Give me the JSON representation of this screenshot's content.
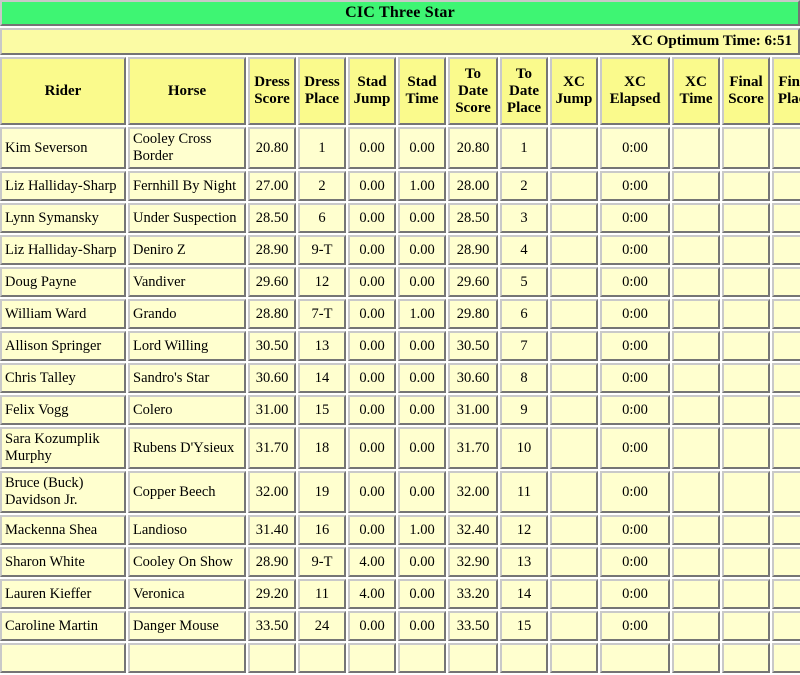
{
  "banner": {
    "title": "CIC Three Star"
  },
  "optimum_time": {
    "label": "XC Optimum Time: 6:51"
  },
  "table": {
    "columns": [
      "Rider",
      "Horse",
      "Dress Score",
      "Dress Place",
      "Stad Jump",
      "Stad Time",
      "To Date Score",
      "To Date Place",
      "XC Jump",
      "XC Elapsed",
      "XC Time",
      "Final Score",
      "Final Place"
    ],
    "column_lines": [
      [
        "Rider"
      ],
      [
        "Horse"
      ],
      [
        "Dress",
        "Score"
      ],
      [
        "Dress",
        "Place"
      ],
      [
        "Stad",
        "Jump"
      ],
      [
        "Stad",
        "Time"
      ],
      [
        "To",
        "Date",
        "Score"
      ],
      [
        "To",
        "Date",
        "Place"
      ],
      [
        "XC",
        "Jump"
      ],
      [
        "XC",
        "Elapsed"
      ],
      [
        "XC",
        "Time"
      ],
      [
        "Final",
        "Score"
      ],
      [
        "Final",
        "Place"
      ]
    ],
    "rows": [
      {
        "rider": "Kim Severson",
        "horse": "Cooley Cross Border",
        "dress_score": "20.80",
        "dress_place": "1",
        "stad_jump": "0.00",
        "stad_time": "0.00",
        "to_date_score": "20.80",
        "to_date_place": "1",
        "xc_jump": "",
        "xc_elapsed": "0:00",
        "xc_time": "",
        "final_score": "",
        "final_place": ""
      },
      {
        "rider": "Liz Halliday-Sharp",
        "horse": "Fernhill By Night",
        "dress_score": "27.00",
        "dress_place": "2",
        "stad_jump": "0.00",
        "stad_time": "1.00",
        "to_date_score": "28.00",
        "to_date_place": "2",
        "xc_jump": "",
        "xc_elapsed": "0:00",
        "xc_time": "",
        "final_score": "",
        "final_place": ""
      },
      {
        "rider": "Lynn Symansky",
        "horse": "Under Suspection",
        "dress_score": "28.50",
        "dress_place": "6",
        "stad_jump": "0.00",
        "stad_time": "0.00",
        "to_date_score": "28.50",
        "to_date_place": "3",
        "xc_jump": "",
        "xc_elapsed": "0:00",
        "xc_time": "",
        "final_score": "",
        "final_place": ""
      },
      {
        "rider": "Liz Halliday-Sharp",
        "horse": "Deniro Z",
        "dress_score": "28.90",
        "dress_place": "9-T",
        "stad_jump": "0.00",
        "stad_time": "0.00",
        "to_date_score": "28.90",
        "to_date_place": "4",
        "xc_jump": "",
        "xc_elapsed": "0:00",
        "xc_time": "",
        "final_score": "",
        "final_place": ""
      },
      {
        "rider": "Doug Payne",
        "horse": "Vandiver",
        "dress_score": "29.60",
        "dress_place": "12",
        "stad_jump": "0.00",
        "stad_time": "0.00",
        "to_date_score": "29.60",
        "to_date_place": "5",
        "xc_jump": "",
        "xc_elapsed": "0:00",
        "xc_time": "",
        "final_score": "",
        "final_place": ""
      },
      {
        "rider": "William Ward",
        "horse": "Grando",
        "dress_score": "28.80",
        "dress_place": "7-T",
        "stad_jump": "0.00",
        "stad_time": "1.00",
        "to_date_score": "29.80",
        "to_date_place": "6",
        "xc_jump": "",
        "xc_elapsed": "0:00",
        "xc_time": "",
        "final_score": "",
        "final_place": ""
      },
      {
        "rider": "Allison Springer",
        "horse": "Lord Willing",
        "dress_score": "30.50",
        "dress_place": "13",
        "stad_jump": "0.00",
        "stad_time": "0.00",
        "to_date_score": "30.50",
        "to_date_place": "7",
        "xc_jump": "",
        "xc_elapsed": "0:00",
        "xc_time": "",
        "final_score": "",
        "final_place": ""
      },
      {
        "rider": "Chris Talley",
        "horse": "Sandro's Star",
        "dress_score": "30.60",
        "dress_place": "14",
        "stad_jump": "0.00",
        "stad_time": "0.00",
        "to_date_score": "30.60",
        "to_date_place": "8",
        "xc_jump": "",
        "xc_elapsed": "0:00",
        "xc_time": "",
        "final_score": "",
        "final_place": ""
      },
      {
        "rider": "Felix Vogg",
        "horse": "Colero",
        "dress_score": "31.00",
        "dress_place": "15",
        "stad_jump": "0.00",
        "stad_time": "0.00",
        "to_date_score": "31.00",
        "to_date_place": "9",
        "xc_jump": "",
        "xc_elapsed": "0:00",
        "xc_time": "",
        "final_score": "",
        "final_place": ""
      },
      {
        "rider": "Sara Kozumplik Murphy",
        "horse": "Rubens D'Ysieux",
        "dress_score": "31.70",
        "dress_place": "18",
        "stad_jump": "0.00",
        "stad_time": "0.00",
        "to_date_score": "31.70",
        "to_date_place": "10",
        "xc_jump": "",
        "xc_elapsed": "0:00",
        "xc_time": "",
        "final_score": "",
        "final_place": ""
      },
      {
        "rider": "Bruce (Buck) Davidson Jr.",
        "horse": "Copper Beech",
        "dress_score": "32.00",
        "dress_place": "19",
        "stad_jump": "0.00",
        "stad_time": "0.00",
        "to_date_score": "32.00",
        "to_date_place": "11",
        "xc_jump": "",
        "xc_elapsed": "0:00",
        "xc_time": "",
        "final_score": "",
        "final_place": ""
      },
      {
        "rider": "Mackenna Shea",
        "horse": "Landioso",
        "dress_score": "31.40",
        "dress_place": "16",
        "stad_jump": "0.00",
        "stad_time": "1.00",
        "to_date_score": "32.40",
        "to_date_place": "12",
        "xc_jump": "",
        "xc_elapsed": "0:00",
        "xc_time": "",
        "final_score": "",
        "final_place": ""
      },
      {
        "rider": "Sharon White",
        "horse": "Cooley On Show",
        "dress_score": "28.90",
        "dress_place": "9-T",
        "stad_jump": "4.00",
        "stad_time": "0.00",
        "to_date_score": "32.90",
        "to_date_place": "13",
        "xc_jump": "",
        "xc_elapsed": "0:00",
        "xc_time": "",
        "final_score": "",
        "final_place": ""
      },
      {
        "rider": "Lauren Kieffer",
        "horse": "Veronica",
        "dress_score": "29.20",
        "dress_place": "11",
        "stad_jump": "4.00",
        "stad_time": "0.00",
        "to_date_score": "33.20",
        "to_date_place": "14",
        "xc_jump": "",
        "xc_elapsed": "0:00",
        "xc_time": "",
        "final_score": "",
        "final_place": ""
      },
      {
        "rider": "Caroline Martin",
        "horse": "Danger Mouse",
        "dress_score": "33.50",
        "dress_place": "24",
        "stad_jump": "0.00",
        "stad_time": "0.00",
        "to_date_score": "33.50",
        "to_date_place": "15",
        "xc_jump": "",
        "xc_elapsed": "0:00",
        "xc_time": "",
        "final_score": "",
        "final_place": ""
      },
      {
        "rider": "",
        "horse": "",
        "dress_score": "",
        "dress_place": "",
        "stad_jump": "",
        "stad_time": "",
        "to_date_score": "",
        "to_date_place": "",
        "xc_jump": "",
        "xc_elapsed": "",
        "xc_time": "",
        "final_score": "",
        "final_place": ""
      }
    ]
  },
  "colors": {
    "banner_green": "#3ef573",
    "header_yellow": "#fafa8c",
    "cell_yellow": "#ffffcf",
    "border_gray": "#c9c9c9",
    "text": "#000000"
  }
}
